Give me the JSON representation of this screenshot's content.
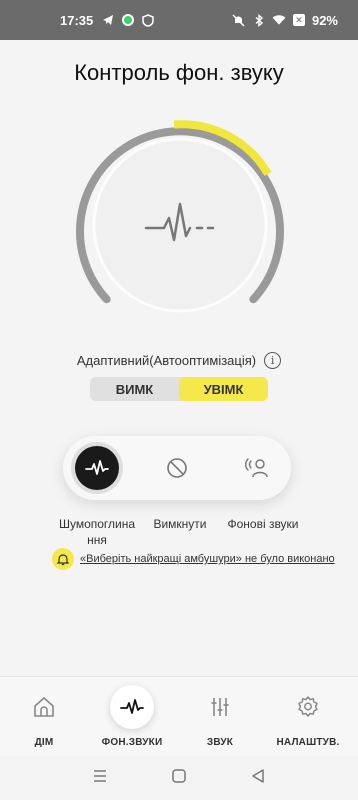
{
  "status_bar": {
    "time": "17:35",
    "battery": "92%",
    "icons_left": [
      "telegram-icon",
      "whatsapp-icon",
      "vpn-shield-icon"
    ],
    "icons_right": [
      "mute-icon",
      "bluetooth-icon",
      "wifi-icon",
      "battery-saver-icon"
    ]
  },
  "header": {
    "title": "Контроль фон. звуку"
  },
  "dial": {
    "level": 0.33,
    "accent_color": "#f0e63c",
    "track_color": "#9a9a9a"
  },
  "adaptive": {
    "label": "Адаптивний(Автооптимізація)",
    "off_label": "ВИМК",
    "on_label": "УВІМК",
    "selected": "on"
  },
  "modes": [
    {
      "label": "Шумопоглина ння",
      "icon": "noise-cancel-icon",
      "active": true
    },
    {
      "label": "Вимкнути",
      "icon": "off-icon",
      "active": false
    },
    {
      "label": "Фонові звуки",
      "icon": "ambient-sound-icon",
      "active": false
    }
  ],
  "notice": {
    "text": "«Виберіть найкращі амбушури» не було виконано"
  },
  "bottom_nav": [
    {
      "label": "ДІМ",
      "icon": "home-icon",
      "active": false
    },
    {
      "label": "ФОН.ЗВУКИ",
      "icon": "waveform-icon",
      "active": true
    },
    {
      "label": "ЗВУК",
      "icon": "equalizer-icon",
      "active": false
    },
    {
      "label": "НАЛАШТУВ.",
      "icon": "gear-icon",
      "active": false
    }
  ],
  "colors": {
    "accent": "#f4e84a",
    "background": "#f4f4f4",
    "status_bar": "#6b6b6b"
  }
}
